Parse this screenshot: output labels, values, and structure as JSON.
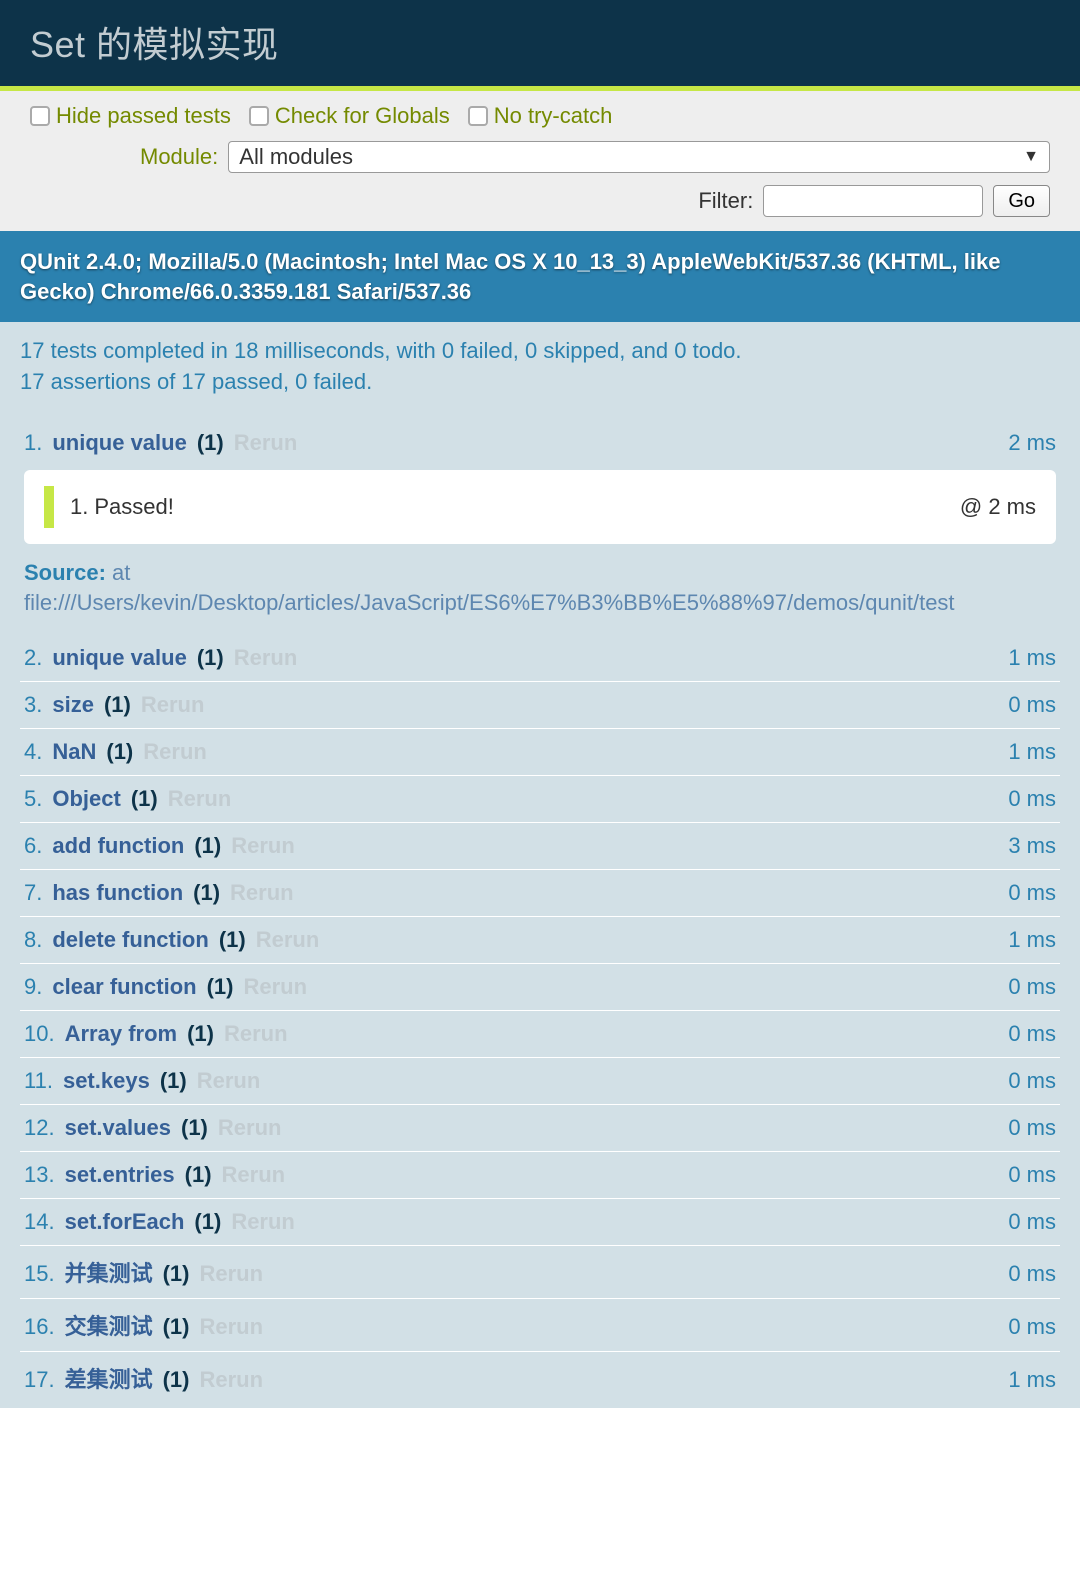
{
  "header": {
    "title": "Set 的模拟实现"
  },
  "toolbar": {
    "hide_passed_label": "Hide passed tests",
    "check_globals_label": "Check for Globals",
    "no_trycatch_label": "No try-catch",
    "module_label": "Module:",
    "module_selected": "All modules",
    "filter_label": "Filter:",
    "filter_value": "",
    "go_label": "Go"
  },
  "useragent": "QUnit 2.4.0; Mozilla/5.0 (Macintosh; Intel Mac OS X 10_13_3) AppleWebKit/537.36 (KHTML, like Gecko) Chrome/66.0.3359.181 Safari/537.36",
  "summary": {
    "line1": "17 tests completed in 18 milliseconds, with 0 failed, 0 skipped, and 0 todo.",
    "line2": "17 assertions of 17 passed, 0 failed."
  },
  "rerun_label": "Rerun",
  "expanded": {
    "num": "1.",
    "name": "unique value",
    "count": "(1)",
    "time": "2 ms",
    "assertion_num": "1.",
    "assertion_text": "Passed!",
    "assertion_time": "@ 2 ms",
    "source_label": "Source:",
    "source_text_prefix": " at ",
    "source_path": "file:///Users/kevin/Desktop/articles/JavaScript/ES6%E7%B3%BB%E5%88%97/demos/qunit/test"
  },
  "tests": [
    {
      "num": "2.",
      "name": "unique value",
      "count": "(1)",
      "time": "1 ms"
    },
    {
      "num": "3.",
      "name": "size",
      "count": "(1)",
      "time": "0 ms"
    },
    {
      "num": "4.",
      "name": "NaN",
      "count": "(1)",
      "time": "1 ms"
    },
    {
      "num": "5.",
      "name": "Object",
      "count": "(1)",
      "time": "0 ms"
    },
    {
      "num": "6.",
      "name": "add function",
      "count": "(1)",
      "time": "3 ms"
    },
    {
      "num": "7.",
      "name": "has function",
      "count": "(1)",
      "time": "0 ms"
    },
    {
      "num": "8.",
      "name": "delete function",
      "count": "(1)",
      "time": "1 ms"
    },
    {
      "num": "9.",
      "name": "clear function",
      "count": "(1)",
      "time": "0 ms"
    },
    {
      "num": "10.",
      "name": "Array from",
      "count": "(1)",
      "time": "0 ms"
    },
    {
      "num": "11.",
      "name": "set.keys",
      "count": "(1)",
      "time": "0 ms"
    },
    {
      "num": "12.",
      "name": "set.values",
      "count": "(1)",
      "time": "0 ms"
    },
    {
      "num": "13.",
      "name": "set.entries",
      "count": "(1)",
      "time": "0 ms"
    },
    {
      "num": "14.",
      "name": "set.forEach",
      "count": "(1)",
      "time": "0 ms"
    },
    {
      "num": "15.",
      "name": "并集测试",
      "count": "(1)",
      "time": "0 ms"
    },
    {
      "num": "16.",
      "name": "交集测试",
      "count": "(1)",
      "time": "0 ms"
    },
    {
      "num": "17.",
      "name": "差集测试",
      "count": "(1)",
      "time": "1 ms"
    }
  ]
}
